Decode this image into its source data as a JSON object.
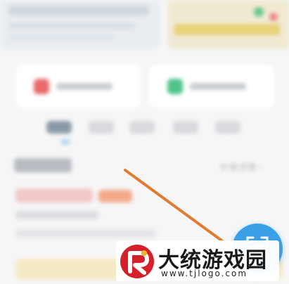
{
  "header": {
    "price_details_label": "价格详情",
    "chevron": "›"
  },
  "watermark": {
    "name": "大统游戏园",
    "url": "www.tjlogo.com"
  },
  "icons": {
    "fab": "scan-icon",
    "watermark_logo": "red-r-logo-icon",
    "annotation": "orange-arrow"
  },
  "colors": {
    "fab": "#3a9fe6",
    "arrow": "#e07b2f",
    "logo": "#d3202a"
  }
}
